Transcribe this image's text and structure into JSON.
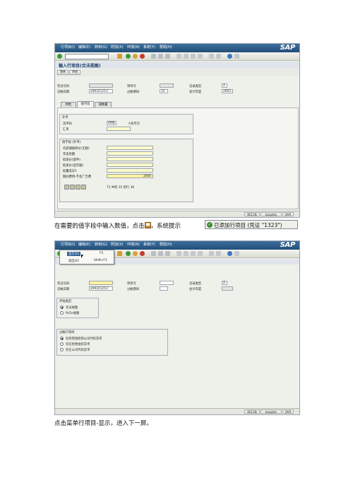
{
  "screen1": {
    "menu": [
      "行项目(I)",
      "编辑(E)",
      "转到(G)",
      "附加(X)",
      "环境(N)",
      "系统(Y)",
      "帮助(H)"
    ],
    "title": "输入行项目(合法视图)",
    "buttons": [
      "领失",
      "评估"
    ],
    "header": {
      "doc_no_label": "凭证号码",
      "doc_no": "",
      "item_no_label": "项目号",
      "item_no": "",
      "rec_type_label": "记录类型",
      "rec_type": "A",
      "post_date_label": "记帐日期",
      "post_date": "2003/12/13",
      "period_label": "过帐期间",
      "period": "12",
      "fiscal_year_label": "会计年度",
      "fiscal_year": "2003"
    },
    "tabs": [
      "特性",
      "值字段",
      "调数量"
    ],
    "currency_group": {
      "title": "外币",
      "currency_label": "货币码",
      "currency": "RMB",
      "currency_name": "人民币元",
      "rate_label": "汇率",
      "rate": ""
    },
    "value_group": {
      "title": "值字段 (外币)",
      "rows": [
        {
          "label": "内部调拨转价(无税)",
          "value": ""
        },
        {
          "label": "年发金额",
          "value": ""
        },
        {
          "label": "批发价(套件)",
          "value": ""
        },
        {
          "label": "批发价(显示器)",
          "value": ""
        },
        {
          "label": "批量差异1",
          "value": ""
        },
        {
          "label": "期间费用-不含广告费",
          "value": "2000"
        }
      ],
      "entry_info": "71 中的 35 的行 36"
    },
    "status": {
      "cell1": "KE11N",
      "cell2": "ksapdev",
      "cell3": "OVR"
    }
  },
  "caption1": {
    "before": "在需要的值字段中输入数值，点击",
    "after": "，系统提示",
    "message": "已添加行项目 (凭证 \"1323\")"
  },
  "screen2": {
    "menu": [
      "行项目(I)",
      "编辑(E)",
      "转到(G)",
      "附加(X)",
      "环境(N)",
      "系统(Y)",
      "帮助(H)"
    ],
    "dropdown": {
      "display": "显示(D)",
      "display_key": "F5",
      "exit": "退出(X)",
      "exit_key": "Shift+F3"
    },
    "header": {
      "doc_no_label": "凭证号码",
      "doc_no": "",
      "item_no_label": "项目号",
      "item_no": "",
      "rec_type_label": "记录类型",
      "rec_type": "A",
      "post_date_label": "记帐日期",
      "post_date": "2003/12/13",
      "period_label": "过帐期间",
      "period": "",
      "fiscal_year_label": "会计年度",
      "fiscal_year": ""
    },
    "eval_group": {
      "title": "评估类型",
      "options": [
        "合法视图",
        "PrCtr视图"
      ]
    },
    "line_group": {
      "title": "过帐行项目",
      "options": [
        "在经营组织和公司代码货币",
        "仅在经营组织货币",
        "仅在公司代码货币"
      ]
    },
    "status": {
      "cell1": "KE11N",
      "cell2": "ksapdev",
      "cell3": "OVR"
    }
  },
  "caption2": "点击菜单行项目-显示，进入下一屏。"
}
